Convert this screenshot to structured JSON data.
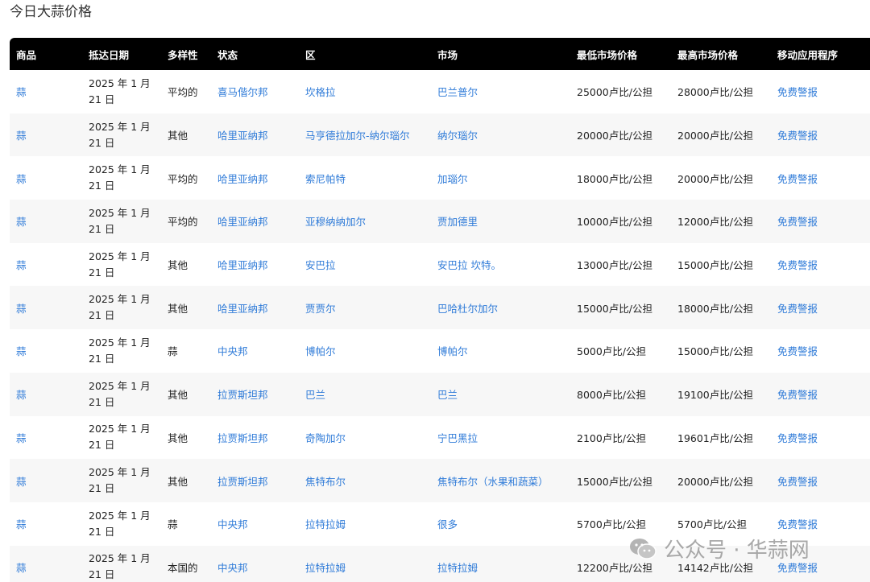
{
  "page": {
    "title": "今日大蒜价格"
  },
  "table": {
    "headers": [
      "商品",
      "抵达日期",
      "多样性",
      "状态",
      "区",
      "市场",
      "最低市场价格",
      "最高市场价格",
      "移动应用程序"
    ],
    "rows": [
      {
        "commodity": "蒜",
        "date": "2025 年 1 月 21 日",
        "variety": "平均的",
        "state": "喜马偕尔邦",
        "district": "坎格拉",
        "market": "巴兰普尔",
        "min_price": "25000卢比/公担",
        "max_price": "28000卢比/公担",
        "app": "免费警报"
      },
      {
        "commodity": "蒜",
        "date": "2025 年 1 月 21 日",
        "variety": "其他",
        "state": "哈里亚纳邦",
        "district": "马亨德拉加尔-纳尔瑙尔",
        "market": "纳尔瑙尔",
        "min_price": "20000卢比/公担",
        "max_price": "20000卢比/公担",
        "app": "免费警报"
      },
      {
        "commodity": "蒜",
        "date": "2025 年 1 月 21 日",
        "variety": "平均的",
        "state": "哈里亚纳邦",
        "district": "索尼帕特",
        "market": "加瑙尔",
        "min_price": "18000卢比/公担",
        "max_price": "20000卢比/公担",
        "app": "免费警报"
      },
      {
        "commodity": "蒜",
        "date": "2025 年 1 月 21 日",
        "variety": "平均的",
        "state": "哈里亚纳邦",
        "district": "亚穆纳纳加尔",
        "market": "贾加德里",
        "min_price": "10000卢比/公担",
        "max_price": "12000卢比/公担",
        "app": "免费警报"
      },
      {
        "commodity": "蒜",
        "date": "2025 年 1 月 21 日",
        "variety": "其他",
        "state": "哈里亚纳邦",
        "district": "安巴拉",
        "market": "安巴拉 坎特。",
        "min_price": "13000卢比/公担",
        "max_price": "15000卢比/公担",
        "app": "免费警报"
      },
      {
        "commodity": "蒜",
        "date": "2025 年 1 月 21 日",
        "variety": "其他",
        "state": "哈里亚纳邦",
        "district": "贾贾尔",
        "market": "巴哈杜尔加尔",
        "min_price": "15000卢比/公担",
        "max_price": "18000卢比/公担",
        "app": "免费警报"
      },
      {
        "commodity": "蒜",
        "date": "2025 年 1 月 21 日",
        "variety": "蒜",
        "state": "中央邦",
        "district": "博帕尔",
        "market": "博帕尔",
        "min_price": "5000卢比/公担",
        "max_price": "15000卢比/公担",
        "app": "免费警报"
      },
      {
        "commodity": "蒜",
        "date": "2025 年 1 月 21 日",
        "variety": "其他",
        "state": "拉贾斯坦邦",
        "district": "巴兰",
        "market": "巴兰",
        "min_price": "8000卢比/公担",
        "max_price": "19100卢比/公担",
        "app": "免费警报"
      },
      {
        "commodity": "蒜",
        "date": "2025 年 1 月 21 日",
        "variety": "其他",
        "state": "拉贾斯坦邦",
        "district": "奇陶加尔",
        "market": "宁巴黑拉",
        "min_price": "2100卢比/公担",
        "max_price": "19601卢比/公担",
        "app": "免费警报"
      },
      {
        "commodity": "蒜",
        "date": "2025 年 1 月 21 日",
        "variety": "其他",
        "state": "拉贾斯坦邦",
        "district": "焦特布尔",
        "market": "焦特布尔（水果和蔬菜）",
        "min_price": "15000卢比/公担",
        "max_price": "20000卢比/公担",
        "app": "免费警报"
      },
      {
        "commodity": "蒜",
        "date": "2025 年 1 月 21 日",
        "variety": "蒜",
        "state": "中央邦",
        "district": "拉特拉姆",
        "market": "很多",
        "min_price": "5700卢比/公担",
        "max_price": "5700卢比/公担",
        "app": "免费警报"
      },
      {
        "commodity": "蒜",
        "date": "2025 年 1 月 21 日",
        "variety": "本国的",
        "state": "中央邦",
        "district": "拉特拉姆",
        "market": "拉特拉姆",
        "min_price": "12200卢比/公担",
        "max_price": "14142卢比/公担",
        "app": "免费警报"
      }
    ]
  },
  "watermark": {
    "text": "公众号 · 华蒜网",
    "icon": "wechat-icon"
  }
}
